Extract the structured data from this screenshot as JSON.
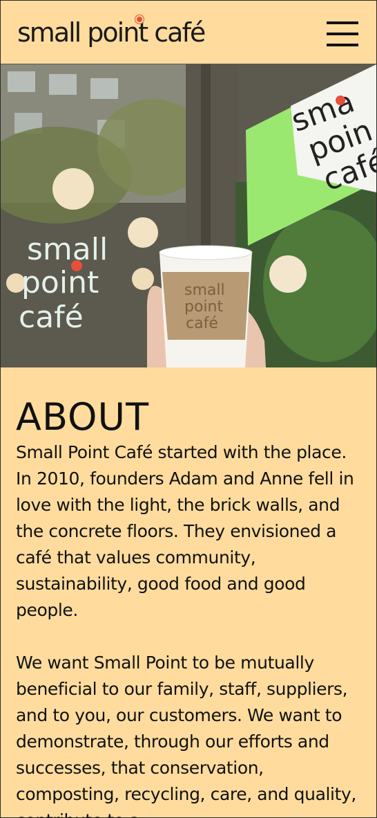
{
  "header": {
    "logo_text": "small point café",
    "menu_icon": "hamburger-menu-icon"
  },
  "hero": {
    "window_logo_lines": [
      "small",
      "point",
      "café"
    ],
    "sign_lines": [
      "sma",
      "poin",
      "café"
    ],
    "cup_lines": [
      "small",
      "point",
      "café"
    ]
  },
  "about": {
    "heading": "ABOUT",
    "paragraph_1": "Small Point Café started with the place. In 2010, founders Adam and Anne fell in love with the light, the brick walls, and the concrete floors. They envisioned a café that values community, sustainability, good food and good people.",
    "paragraph_2": "We want Small Point to be mutually beneficial to our family, staff, suppliers, and to you, our customers. We want to demonstrate, through our efforts and successes, that conservation, composting, recycling, care, and quality, contribute to a"
  },
  "colors": {
    "background": "#ffdc9e",
    "accent_dot": "#e8503a",
    "sign_green": "#8fe06a"
  }
}
